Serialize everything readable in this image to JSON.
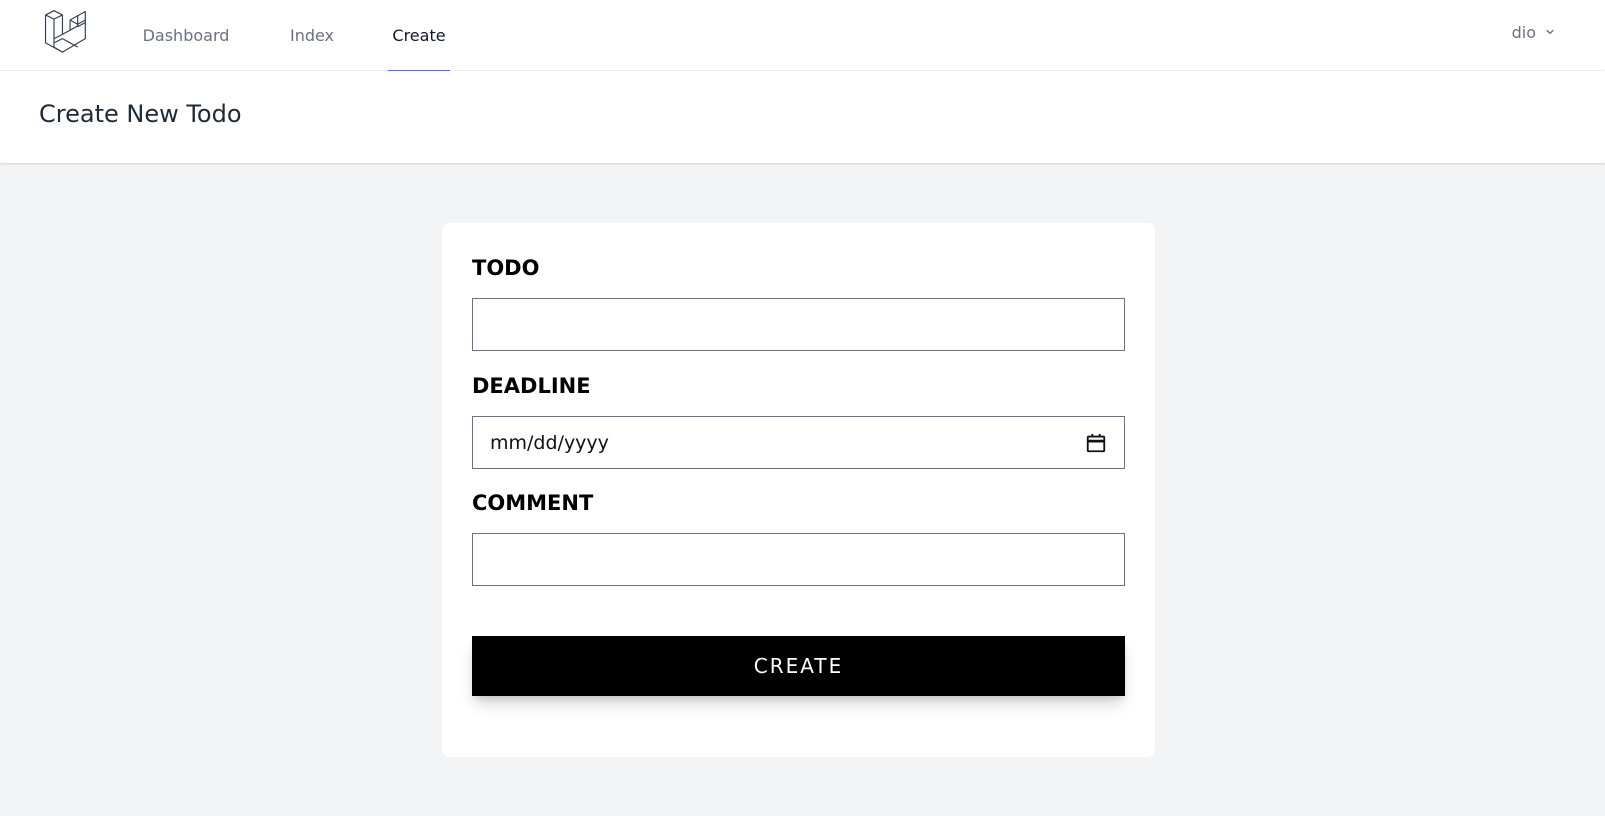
{
  "nav": {
    "links": [
      {
        "label": "Dashboard",
        "active": false
      },
      {
        "label": "Index",
        "active": false
      },
      {
        "label": "Create",
        "active": true
      }
    ],
    "user": {
      "name": "dio"
    }
  },
  "header": {
    "title": "Create New Todo"
  },
  "form": {
    "todo": {
      "label": "TODO",
      "value": ""
    },
    "deadline": {
      "label": "DEADLINE",
      "value": "mm/dd/yyyy"
    },
    "comment": {
      "label": "COMMENT",
      "value": ""
    },
    "submit_label": "CREATE"
  },
  "colors": {
    "accent": "#6366f1",
    "background": "#f3f4f6",
    "button": "#000000"
  },
  "icons": {
    "logo": "laravel-logo-icon",
    "user_dropdown": "chevron-down-icon",
    "date_picker": "calendar-icon"
  }
}
